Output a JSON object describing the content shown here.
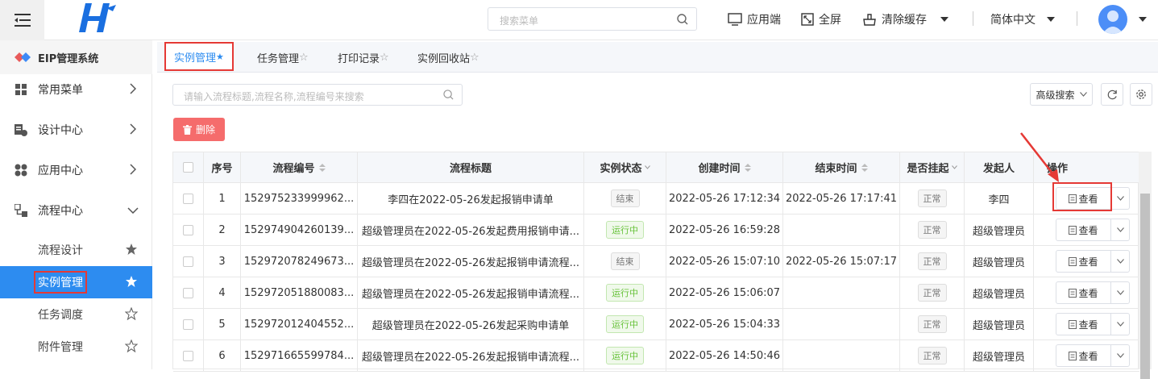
{
  "topbar": {
    "search_placeholder": "搜索菜单",
    "items": [
      {
        "label": "应用端",
        "icon": "monitor-icon"
      },
      {
        "label": "全屏",
        "icon": "fullscreen-icon"
      },
      {
        "label": "清除缓存",
        "icon": "clear-cache-icon"
      },
      {
        "label": "简体中文"
      }
    ]
  },
  "sidebar": {
    "system_name": "EIP管理系统",
    "menus": [
      {
        "label": "常用菜单",
        "icon": "grid-icon"
      },
      {
        "label": "设计中心",
        "icon": "design-icon"
      },
      {
        "label": "应用中心",
        "icon": "app-icon"
      },
      {
        "label": "流程中心",
        "icon": "flow-icon"
      }
    ],
    "subitems": [
      {
        "label": "流程设计",
        "starred": true
      },
      {
        "label": "实例管理",
        "starred": true,
        "active": true
      },
      {
        "label": "任务调度",
        "starred": false
      },
      {
        "label": "附件管理",
        "starred": false
      }
    ]
  },
  "tabs": [
    {
      "label": "实例管理",
      "active": true,
      "star": "★"
    },
    {
      "label": "任务管理",
      "star": "☆"
    },
    {
      "label": "打印记录",
      "star": "☆"
    },
    {
      "label": "实例回收站",
      "star": "☆"
    }
  ],
  "toolbar": {
    "search_placeholder": "请输入流程标题,流程名称,流程编号来搜索",
    "advanced_search": "高级搜索",
    "delete_label": "删除"
  },
  "table": {
    "headers": [
      "序号",
      "流程编号",
      "流程标题",
      "实例状态",
      "创建时间",
      "结束时间",
      "是否挂起",
      "发起人",
      "操作"
    ],
    "rows": [
      {
        "no": "1",
        "code": "152975233999962...",
        "title": "李四在2022-05-26发起报销申请单",
        "status": "结束",
        "running": false,
        "created": "2022-05-26 17:12:34",
        "ended": "2022-05-26 17:17:41",
        "suspend": "正常",
        "initiator": "李四",
        "action": "查看"
      },
      {
        "no": "2",
        "code": "152974904260139...",
        "title": "超级管理员在2022-05-26发起费用报销申请...",
        "status": "运行中",
        "running": true,
        "created": "2022-05-26 16:59:28",
        "ended": "",
        "suspend": "正常",
        "initiator": "超级管理员",
        "action": "查看"
      },
      {
        "no": "3",
        "code": "152972078249673...",
        "title": "超级管理员在2022-05-26发起报销申请流程...",
        "status": "结束",
        "running": false,
        "created": "2022-05-26 15:07:10",
        "ended": "2022-05-26 15:07:17",
        "suspend": "正常",
        "initiator": "超级管理员",
        "action": "查看"
      },
      {
        "no": "4",
        "code": "152972051880083...",
        "title": "超级管理员在2022-05-26发起报销申请流程...",
        "status": "运行中",
        "running": true,
        "created": "2022-05-26 15:06:07",
        "ended": "",
        "suspend": "正常",
        "initiator": "超级管理员",
        "action": "查看"
      },
      {
        "no": "5",
        "code": "152972012404552...",
        "title": "超级管理员在2022-05-26发起采购申请单",
        "status": "运行中",
        "running": true,
        "created": "2022-05-26 15:04:33",
        "ended": "",
        "suspend": "正常",
        "initiator": "超级管理员",
        "action": "查看"
      },
      {
        "no": "6",
        "code": "152971665599784...",
        "title": "超级管理员在2022-05-26发起报销申请流程...",
        "status": "运行中",
        "running": true,
        "created": "2022-05-26 14:50:46",
        "ended": "",
        "suspend": "正常",
        "initiator": "超级管理员",
        "action": "查看"
      }
    ]
  },
  "colors": {
    "accent": "#2d8cf0",
    "danger": "#f56c6c",
    "highlight": "#e53935",
    "running": "#67c23a"
  }
}
